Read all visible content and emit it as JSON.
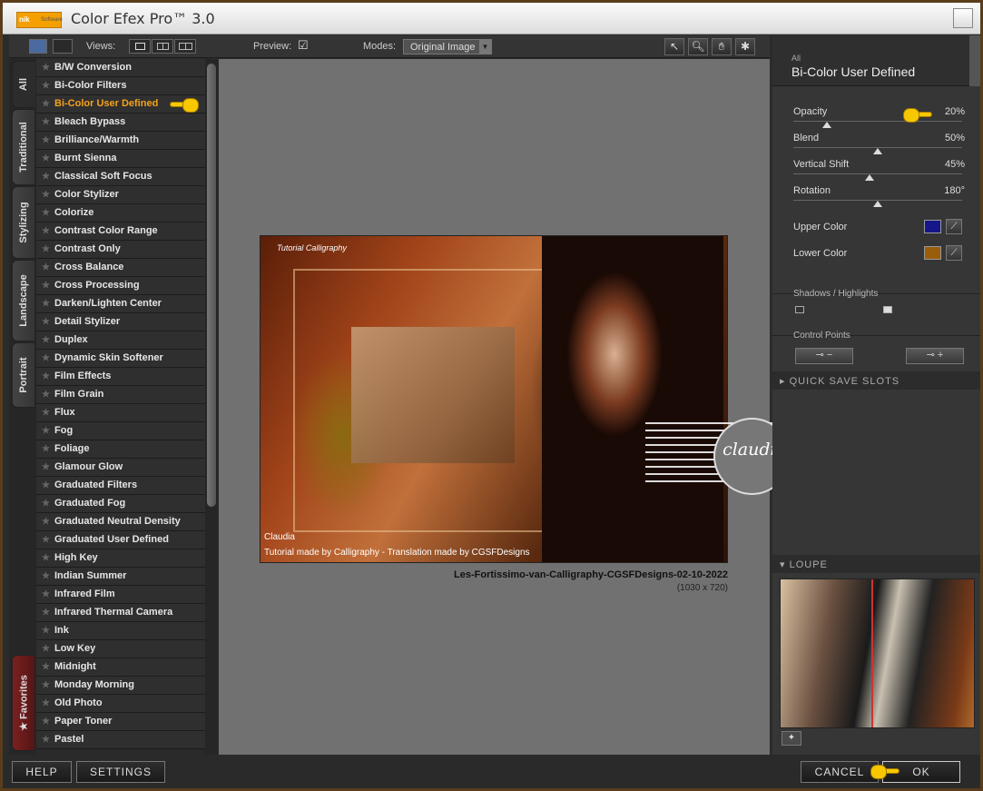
{
  "window": {
    "title": "Color Efex Pro™ 3.0",
    "logo_text": "nik",
    "logo_sub": "Software"
  },
  "toolbar": {
    "views_label": "Views:",
    "preview_label": "Preview:",
    "preview_checked": true,
    "preview_check_glyph": "☑",
    "modes_label": "Modes:",
    "modes_value": "Original Image"
  },
  "tabs": [
    "All",
    "Traditional",
    "Stylizing",
    "Landscape",
    "Portrait"
  ],
  "favorites_tab": "Favorites",
  "favorites_star": "★",
  "filter_star": "★",
  "filters": [
    "B/W Conversion",
    "Bi-Color Filters",
    "Bi-Color User Defined",
    "Bleach Bypass",
    "Brilliance/Warmth",
    "Burnt Sienna",
    "Classical Soft Focus",
    "Color Stylizer",
    "Colorize",
    "Contrast Color Range",
    "Contrast Only",
    "Cross Balance",
    "Cross Processing",
    "Darken/Lighten Center",
    "Detail Stylizer",
    "Duplex",
    "Dynamic Skin Softener",
    "Film Effects",
    "Film Grain",
    "Flux",
    "Fog",
    "Foliage",
    "Glamour Glow",
    "Graduated Filters",
    "Graduated Fog",
    "Graduated Neutral Density",
    "Graduated User Defined",
    "High Key",
    "Indian Summer",
    "Infrared Film",
    "Infrared Thermal Camera",
    "Ink",
    "Low Key",
    "Midnight",
    "Monday Morning",
    "Old Photo",
    "Paper Toner",
    "Pastel"
  ],
  "selected_filter": "Bi-Color User Defined",
  "canvas": {
    "image_overlay_title": "Tutorial Calligraphy",
    "image_caption_name": "Claudia",
    "image_credit": "Tutorial made by Calligraphy - Translation made by CGSFDesigns",
    "watermark": "claudia",
    "file_name": "Les-Fortissimo-van-Calligraphy-CGSFDesigns-02-10-2022",
    "file_dims": "(1030 x 720)"
  },
  "panel": {
    "category": "All",
    "filter_name": "Bi-Color User Defined",
    "sliders": [
      {
        "label": "Opacity",
        "value": "20%",
        "level": 0.2
      },
      {
        "label": "Blend",
        "value": "50%",
        "level": 0.5
      },
      {
        "label": "Vertical Shift",
        "value": "45%",
        "level": 0.45
      },
      {
        "label": "Rotation",
        "value": "180°",
        "level": 0.5
      }
    ],
    "upper_color_label": "Upper Color",
    "upper_color": "#15168a",
    "lower_color_label": "Lower Color",
    "lower_color": "#9a5d0a",
    "shadows_label": "Shadows / Highlights",
    "control_points_label": "Control Points",
    "quick_save_label": "QUICK SAVE SLOTS",
    "loupe_label": "LOUPE"
  },
  "buttons": {
    "help": "HELP",
    "settings": "SETTINGS",
    "cancel": "CANCEL",
    "ok": "OK"
  },
  "colors": {
    "accent": "#f5a21a"
  }
}
